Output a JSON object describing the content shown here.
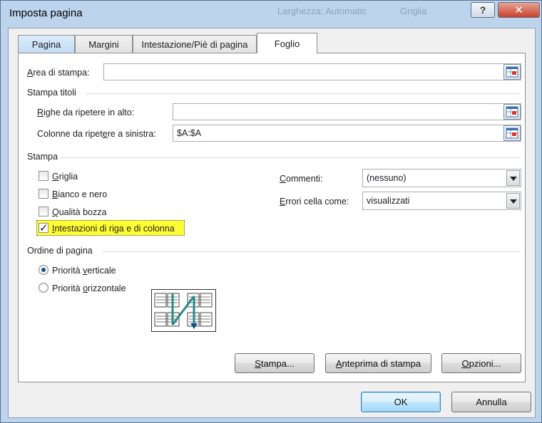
{
  "window": {
    "title": "Imposta pagina",
    "ghost_texts": [
      "Larghezza: Automatic",
      "Griglia"
    ],
    "help_glyph": "?",
    "close_glyph": "✕"
  },
  "tabs": [
    {
      "label": "Pagina"
    },
    {
      "label": "Margini"
    },
    {
      "label": "Intestazione/Piè di pagina"
    },
    {
      "label": "Foglio",
      "active": true
    }
  ],
  "print_area": {
    "label_u": "A",
    "label_rest": "rea di stampa:",
    "value": ""
  },
  "print_titles": {
    "section": "Stampa titoli",
    "rows_u": "R",
    "rows_rest": "ighe da ripetere in alto:",
    "rows_value": "",
    "cols_pre": "Colonne da ripet",
    "cols_u": "e",
    "cols_rest": "re a sinistra:",
    "cols_value": "$A:$A"
  },
  "print": {
    "section": "Stampa",
    "checkboxes": [
      {
        "u": "G",
        "rest": "riglia",
        "checked": false
      },
      {
        "u": "B",
        "rest": "ianco e nero",
        "checked": false
      },
      {
        "u": "Q",
        "rest": "ualità bozza",
        "checked": false
      },
      {
        "u": "I",
        "rest": "ntestazioni di riga e di colonna",
        "checked": true
      }
    ],
    "comments_u": "C",
    "comments_rest": "ommenti:",
    "comments_value": "(nessuno)",
    "errors_u": "E",
    "errors_rest": "rrori cella come:",
    "errors_value": "visualizzati"
  },
  "page_order": {
    "section": "Ordine di pagina",
    "opt1_pre": "Priorità ",
    "opt1_u": "v",
    "opt1_rest": "erticale",
    "opt1_selected": true,
    "opt2_pre": "Priorità ",
    "opt2_u": "o",
    "opt2_rest": "rizzontale",
    "opt2_selected": false
  },
  "panel_buttons": {
    "print_u": "S",
    "print_rest": "tampa...",
    "preview_u": "A",
    "preview_rest": "nteprima di stampa",
    "options_u": "O",
    "options_rest": "pzioni..."
  },
  "footer": {
    "ok": "OK",
    "cancel": "Annulla"
  },
  "colors": {
    "highlight": "#fffe33",
    "accent": "#1b4c86",
    "close": "#c8432b"
  }
}
